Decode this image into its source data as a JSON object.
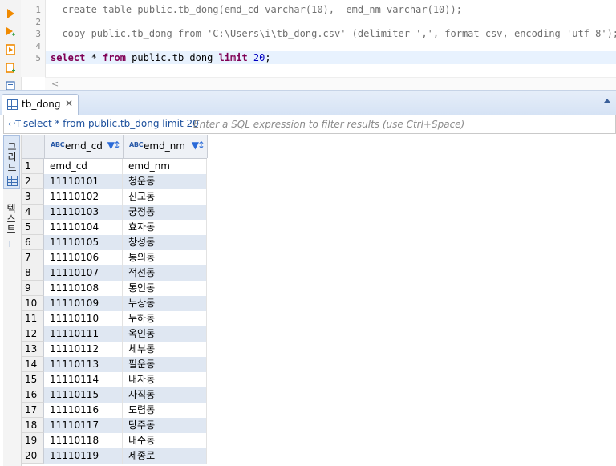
{
  "editor": {
    "lines": [
      {
        "no": "1",
        "text": "--create table public.tb_dong(emd_cd varchar(10),  emd_nm varchar(10));"
      },
      {
        "no": "2",
        "text": ""
      },
      {
        "no": "3",
        "text": "--copy public.tb_dong from 'C:\\Users\\i\\tb_dong.csv' (delimiter ',', format csv, encoding 'utf-8');"
      },
      {
        "no": "4",
        "text": ""
      },
      {
        "no": "5",
        "select_kw": "select",
        "mid1": " * ",
        "from_kw": "from",
        "mid2": " public.tb_dong ",
        "limit_kw": "limit",
        "space": " ",
        "num": "20",
        "end": ";"
      }
    ],
    "scroll_left": "<"
  },
  "results_tab": {
    "label": "tb_dong",
    "close": "✕"
  },
  "filter": {
    "icon": "↩T",
    "sql": "select * from public.tb_dong limit 20",
    "placeholder": "Enter a SQL expression to filter results (use Ctrl+Space)"
  },
  "side_tabs": {
    "grid": "그리드",
    "text": "텍스트"
  },
  "grid": {
    "type_badge": "ABC",
    "columns": [
      "emd_cd",
      "emd_nm"
    ],
    "rows": [
      [
        "1",
        "emd_cd",
        "emd_nm"
      ],
      [
        "2",
        "11110101",
        "청운동"
      ],
      [
        "3",
        "11110102",
        "신교동"
      ],
      [
        "4",
        "11110103",
        "궁정동"
      ],
      [
        "5",
        "11110104",
        "효자동"
      ],
      [
        "6",
        "11110105",
        "창성동"
      ],
      [
        "7",
        "11110106",
        "통의동"
      ],
      [
        "8",
        "11110107",
        "적선동"
      ],
      [
        "9",
        "11110108",
        "통인동"
      ],
      [
        "10",
        "11110109",
        "누상동"
      ],
      [
        "11",
        "11110110",
        "누하동"
      ],
      [
        "12",
        "11110111",
        "옥인동"
      ],
      [
        "13",
        "11110112",
        "체부동"
      ],
      [
        "14",
        "11110113",
        "필운동"
      ],
      [
        "15",
        "11110114",
        "내자동"
      ],
      [
        "16",
        "11110115",
        "사직동"
      ],
      [
        "17",
        "11110116",
        "도렴동"
      ],
      [
        "18",
        "11110117",
        "당주동"
      ],
      [
        "19",
        "11110118",
        "내수동"
      ],
      [
        "20",
        "11110119",
        "세종로"
      ]
    ]
  },
  "colors": {
    "accent": "#3b6eb4",
    "keyword": "#7f0055",
    "number": "#0000c0",
    "alt_row": "#dfe7f2"
  }
}
